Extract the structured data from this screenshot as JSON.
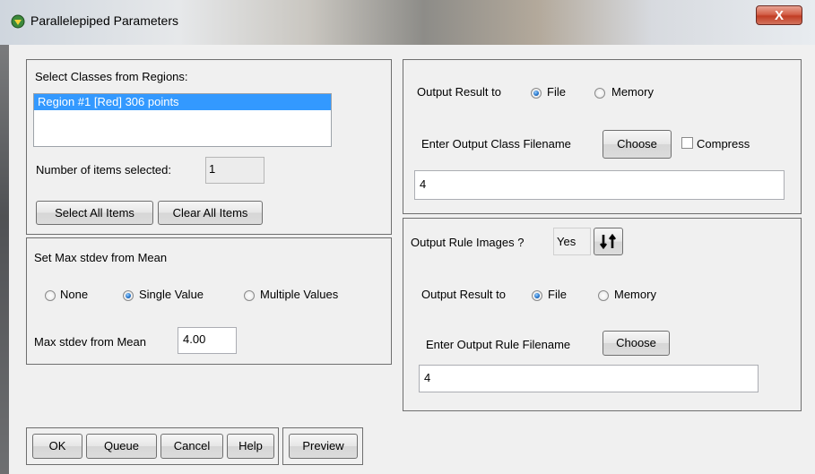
{
  "window": {
    "title": "Parallelepiped Parameters",
    "close_glyph": "X"
  },
  "classes": {
    "label": "Select Classes from Regions:",
    "items": [
      "Region #1 [Red] 306 points"
    ],
    "count_label": "Number of items selected:",
    "count_value": "1",
    "select_all": "Select All Items",
    "clear_all": "Clear All Items"
  },
  "stdev": {
    "title": "Set Max stdev from Mean",
    "options": [
      "None",
      "Single Value",
      "Multiple Values"
    ],
    "selected": "Single Value",
    "value_label": "Max stdev from Mean",
    "value": "4.00"
  },
  "output_class": {
    "result_label": "Output Result to",
    "opt_file": "File",
    "opt_memory": "Memory",
    "selected": "File",
    "filename_label": "Enter Output Class Filename",
    "choose": "Choose",
    "compress": "Compress",
    "compress_checked": false,
    "filename": "4"
  },
  "output_rule": {
    "images_label": "Output Rule Images ?",
    "images_value": "Yes",
    "toggle_icon": "sort-arrows-icon",
    "result_label": "Output Result to",
    "opt_file": "File",
    "opt_memory": "Memory",
    "selected": "File",
    "filename_label": "Enter Output Rule Filename",
    "choose": "Choose",
    "filename": "4"
  },
  "footer": {
    "ok": "OK",
    "queue": "Queue",
    "cancel": "Cancel",
    "help": "Help",
    "preview": "Preview"
  },
  "colors": {
    "selection": "#3399ff",
    "radio_on": "#1f6fc6",
    "close_button": "#c13d24"
  }
}
